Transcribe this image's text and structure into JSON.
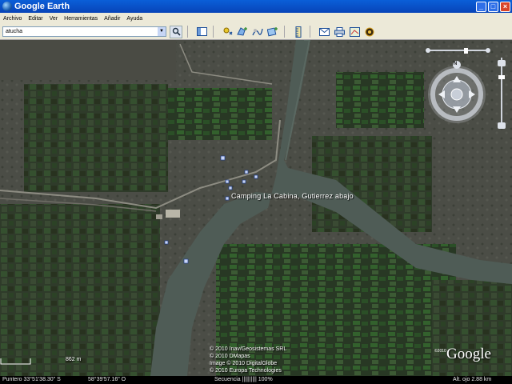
{
  "window": {
    "title": "Google Earth",
    "minimize_label": "_",
    "maximize_label": "□",
    "close_label": "×"
  },
  "menu": {
    "items": [
      "Archivo",
      "Editar",
      "Ver",
      "Herramientas",
      "Añadir",
      "Ayuda"
    ]
  },
  "toolbar": {
    "search_value": "atucha",
    "search_dropdown_icon": "chevron-down-icon",
    "search_button_icon": "magnifier-icon"
  },
  "map": {
    "placemark_label": "Camping La Cabina, Gutierrez abajo",
    "copyright_lines": [
      "© 2010 Inav/Geosistemas SRL",
      "© 2010 DMapas",
      "Image © 2010 DigitalGlobe",
      "© 2010 Europa Technologies"
    ],
    "logo_text": "Google",
    "logo_year": "©2010",
    "scale_label": "862 m",
    "nav_north_label": "N"
  },
  "status": {
    "pointer": "Puntero  33°51'38.30\" S",
    "longitude": "58°39'57.16\" O",
    "streaming": "Secuencia |||||||||| 100%",
    "altitude": "Alt. ojo   2.88 km"
  }
}
